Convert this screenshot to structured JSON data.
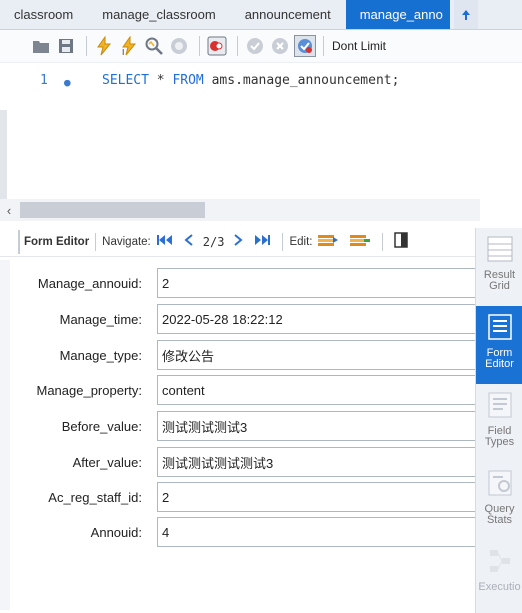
{
  "tabs": [
    {
      "label": "classroom",
      "active": false
    },
    {
      "label": "manage_classroom",
      "active": false
    },
    {
      "label": "announcement",
      "active": false
    },
    {
      "label": "manage_anno",
      "active": true
    }
  ],
  "query_toolbar": {
    "icons": [
      "folder-icon",
      "save-icon",
      "execute-icon",
      "execute-current-icon",
      "explain-icon",
      "stop-icon",
      "beautify-icon",
      "commit-icon",
      "rollback-icon",
      "autocommit-icon"
    ],
    "limit_label": "Dont Limit"
  },
  "editor": {
    "line_number": "1",
    "code": {
      "select": "SELECT",
      "star": " * ",
      "from": "FROM",
      "rest": " ams.manage_announcement;"
    }
  },
  "results_toolbar": {
    "form_editor_label": "Form Editor",
    "navigate_label": "Navigate:",
    "record_position": "2/3",
    "edit_label": "Edit:"
  },
  "form": {
    "fields": [
      {
        "label": "Manage_annouid:",
        "value": "2"
      },
      {
        "label": "Manage_time:",
        "value": "2022-05-28 18:22:12"
      },
      {
        "label": "Manage_type:",
        "value": "修改公告"
      },
      {
        "label": "Manage_property:",
        "value": "content"
      },
      {
        "label": "Before_value:",
        "value": "测试测试测试3"
      },
      {
        "label": "After_value:",
        "value": "测试测试测试测试3"
      },
      {
        "label": "Ac_reg_staff_id:",
        "value": "2"
      },
      {
        "label": "Annouid:",
        "value": "4"
      }
    ]
  },
  "sidebar": {
    "items": [
      {
        "label": "Result\nGrid",
        "state": "normal"
      },
      {
        "label": "Form\nEditor",
        "state": "active"
      },
      {
        "label": "Field\nTypes",
        "state": "normal"
      },
      {
        "label": "Query\nStats",
        "state": "normal"
      },
      {
        "label": "Executio",
        "state": "disabled"
      }
    ]
  },
  "colors": {
    "accent": "#1a73d4",
    "keyword": "#1f6fd6"
  }
}
